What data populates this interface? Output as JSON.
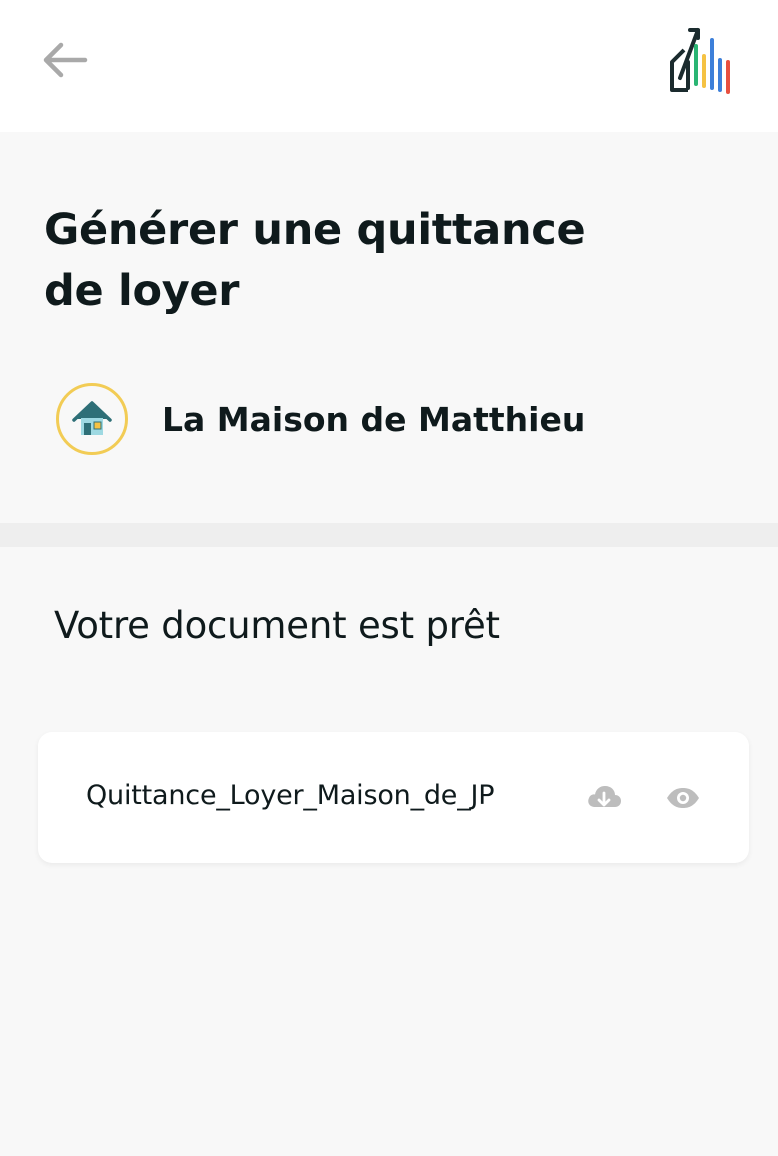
{
  "topbar": {
    "back_icon": "arrow-left-icon",
    "logo_icon": "house-chart-logo-icon",
    "logo_colors": [
      "#1b2b2e",
      "#2ab573",
      "#f5c243",
      "#3d7fd9",
      "#e8503f"
    ]
  },
  "header": {
    "title": "Générer une quittance de loyer"
  },
  "property": {
    "icon": "house-icon",
    "name": "La Maison de Matthieu",
    "accent": "#f2cc55"
  },
  "document_section": {
    "title": "Votre document est prêt"
  },
  "document": {
    "filename": "Quittance_Loyer_Maison_de_JP",
    "download_icon": "cloud-download-icon",
    "view_icon": "eye-icon"
  }
}
